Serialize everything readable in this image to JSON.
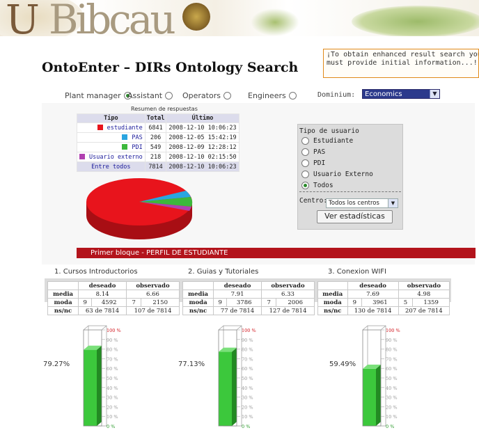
{
  "header": {
    "banner_text": "UBibcau",
    "title": "OntoEnter – DIRs Ontology Search",
    "hint": [
      "¡To obtain enhanced result search you",
      "must provide initial information...!"
    ]
  },
  "roles": [
    {
      "label": "Plant manager",
      "selected": true
    },
    {
      "label": "Assistant",
      "selected": false
    },
    {
      "label": "Operators",
      "selected": false
    },
    {
      "label": "Engineers",
      "selected": false
    }
  ],
  "dominium": {
    "label": "Dominium:",
    "value": "Economics"
  },
  "resumen": {
    "title": "Resumen de respuestas",
    "headers": [
      "Tipo",
      "Total",
      "Último"
    ],
    "rows": [
      {
        "tipo": "estudiante",
        "total": "6841",
        "ultimo": "2008-12-10 10:06:23",
        "color": "#e8141c"
      },
      {
        "tipo": "PAS",
        "total": "206",
        "ultimo": "2008-12-05 15:42:19",
        "color": "#2aa5e0"
      },
      {
        "tipo": "PDI",
        "total": "549",
        "ultimo": "2008-12-09 12:28:12",
        "color": "#3cb83c"
      },
      {
        "tipo": "Usuario externo",
        "total": "218",
        "ultimo": "2008-12-10 02:15:50",
        "color": "#b040b0"
      }
    ],
    "total_row": {
      "tipo": "Entre todos",
      "total": "7814",
      "ultimo": "2008-12-10 10:06:23"
    }
  },
  "filter": {
    "title": "Tipo de usuario",
    "options": [
      {
        "label": "Estudiante",
        "selected": false
      },
      {
        "label": "PAS",
        "selected": false
      },
      {
        "label": "PDI",
        "selected": false
      },
      {
        "label": "Usuario Externo",
        "selected": false
      },
      {
        "label": "Todos",
        "selected": true
      }
    ],
    "centro_label": "Centro:",
    "centro_value": "Todos los centros",
    "button": "Ver estadísticas"
  },
  "bloque": "Primer bloque - PERFIL DE ESTUDIANTE",
  "stats": [
    {
      "title": "1. Cursos Introductorios",
      "deseado": "deseado",
      "observado": "observado",
      "media": [
        "8.14",
        "6.66"
      ],
      "moda": [
        "9",
        "4592",
        "7",
        "2150"
      ],
      "nsnc": [
        "63 de 7814",
        "107 de 7814"
      ],
      "pct_label": "79.27%",
      "pct": 0.7927
    },
    {
      "title": "2. Guias y Tutoriales",
      "deseado": "deseado",
      "observado": "observado",
      "media": [
        "7.91",
        "6.33"
      ],
      "moda": [
        "9",
        "3786",
        "7",
        "2006"
      ],
      "nsnc": [
        "77 de 7814",
        "127 de 7814"
      ],
      "pct_label": "77.13%",
      "pct": 0.7713
    },
    {
      "title": "3. Conexion WIFI",
      "deseado": "deseado",
      "observado": "observado",
      "media": [
        "7.69",
        "4.98"
      ],
      "moda": [
        "9",
        "3961",
        "5",
        "1359"
      ],
      "nsnc": [
        "130 de 7814",
        "207 de 7814"
      ],
      "pct_label": "59.49%",
      "pct": 0.5949
    }
  ],
  "row_labels": {
    "media": "media",
    "moda": "moda",
    "nsnc": "ns/nc"
  },
  "gauge_ticks": [
    "100 %",
    "90 %",
    "80 %",
    "70 %",
    "60 %",
    "50 %",
    "40 %",
    "30 %",
    "20 %",
    "10 %",
    "0 %"
  ]
}
